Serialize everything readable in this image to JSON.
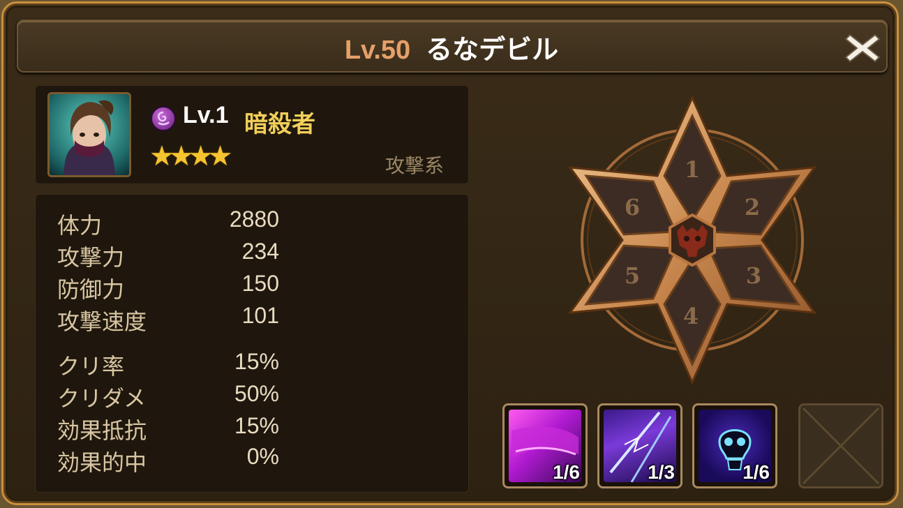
{
  "header": {
    "level": "Lv.50",
    "name": "るなデビル"
  },
  "monster": {
    "attribute_icon": "dark-attribute-icon",
    "level": "Lv.1",
    "name": "暗殺者",
    "stars": 4,
    "type": "攻撃系"
  },
  "stats": [
    {
      "label": "体力",
      "value": "2880"
    },
    {
      "label": "攻撃力",
      "value": "234"
    },
    {
      "label": "防御力",
      "value": "150"
    },
    {
      "label": "攻撃速度",
      "value": "101"
    },
    {
      "label": "クリ率",
      "value": "15%"
    },
    {
      "label": "クリダメ",
      "value": "50%"
    },
    {
      "label": "効果抵抗",
      "value": "15%"
    },
    {
      "label": "効果的中",
      "value": "0%"
    }
  ],
  "rune_slots": [
    "1",
    "2",
    "3",
    "4",
    "5",
    "6"
  ],
  "skills": [
    {
      "level": "1/6",
      "icon": "purple-slash-skill-icon"
    },
    {
      "level": "1/3",
      "icon": "lightning-blade-skill-icon"
    },
    {
      "level": "1/6",
      "icon": "skull-skill-icon"
    }
  ],
  "colors": {
    "frame_gold": "#c9913e",
    "level_orange": "#e6a06a",
    "name_yellow": "#f1cf5a"
  }
}
